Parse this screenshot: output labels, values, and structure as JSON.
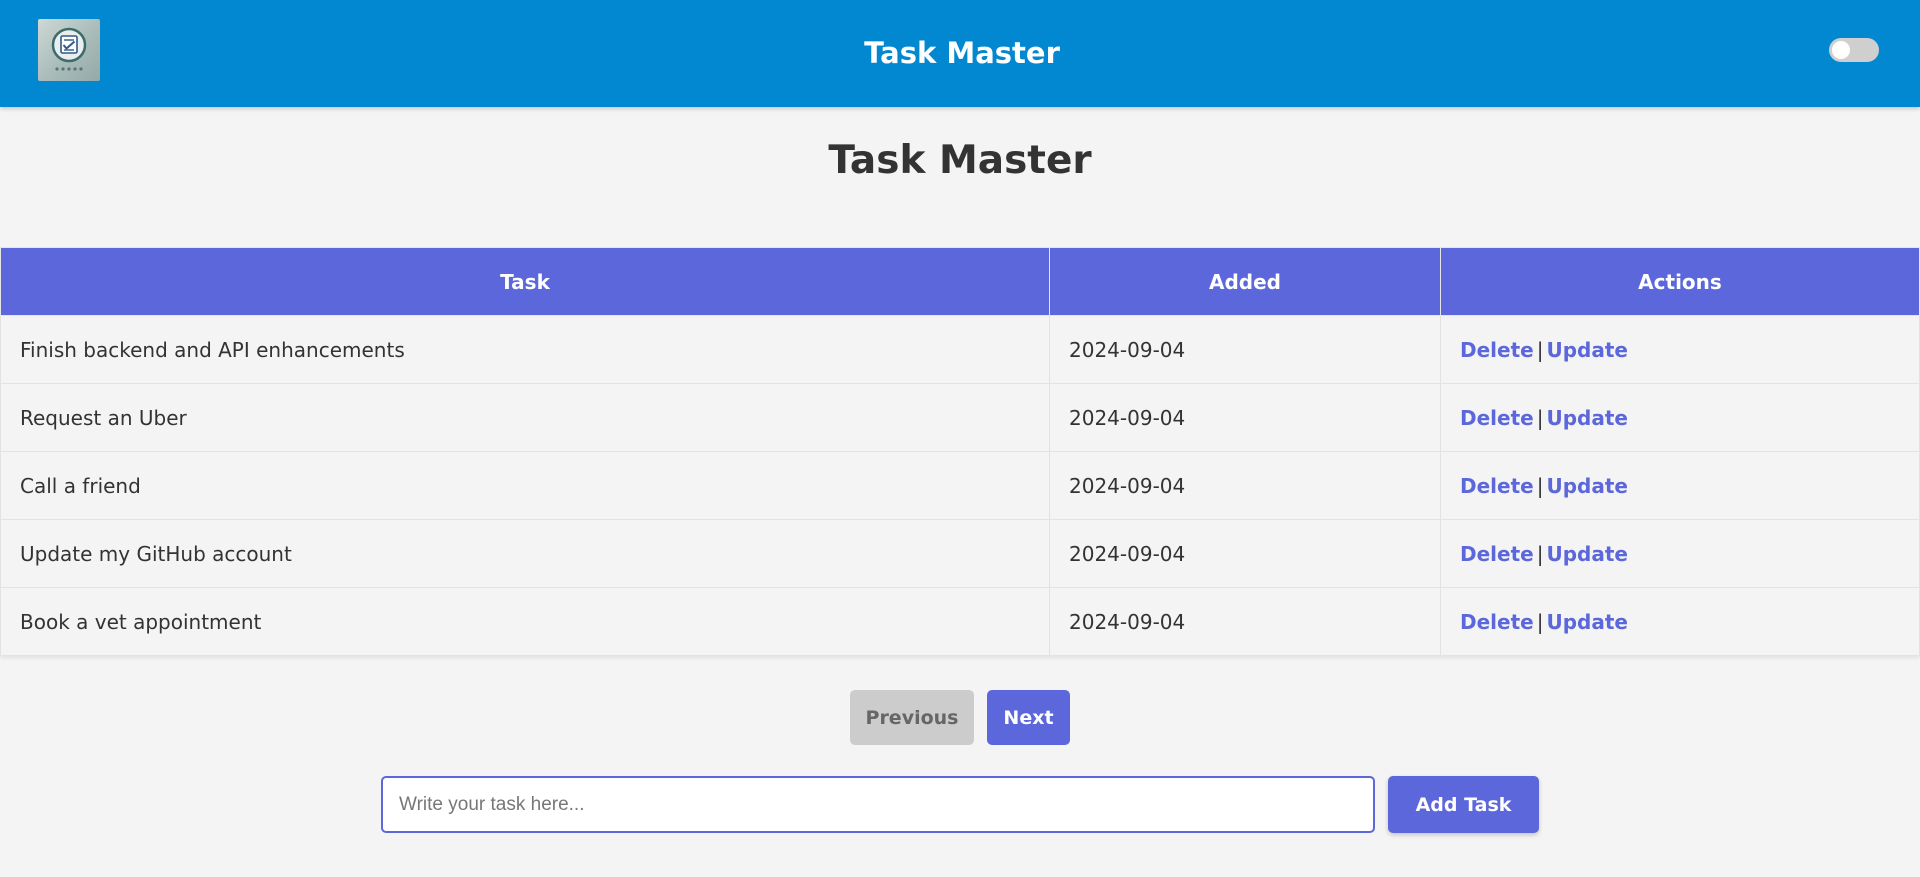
{
  "header": {
    "title": "Task Master",
    "logo_icon": "checklist-logo-icon",
    "theme_toggle": {
      "state": "off"
    }
  },
  "page": {
    "title": "Task Master"
  },
  "table": {
    "columns": [
      "Task",
      "Added",
      "Actions"
    ],
    "rows": [
      {
        "task": "Finish backend and API enhancements",
        "added": "2024-09-04"
      },
      {
        "task": "Request an Uber",
        "added": "2024-09-04"
      },
      {
        "task": "Call a friend",
        "added": "2024-09-04"
      },
      {
        "task": "Update my GitHub account",
        "added": "2024-09-04"
      },
      {
        "task": "Book a vet appointment",
        "added": "2024-09-04"
      }
    ],
    "actions": {
      "delete_label": "Delete",
      "separator": "|",
      "update_label": "Update"
    }
  },
  "pagination": {
    "previous_label": "Previous",
    "next_label": "Next"
  },
  "add_task": {
    "placeholder": "Write your task here...",
    "value": "",
    "button_label": "Add Task"
  },
  "colors": {
    "navbar": "#0288d1",
    "accent": "#5b67da",
    "background": "#f4f4f4",
    "disabled_button": "#cccccc"
  }
}
